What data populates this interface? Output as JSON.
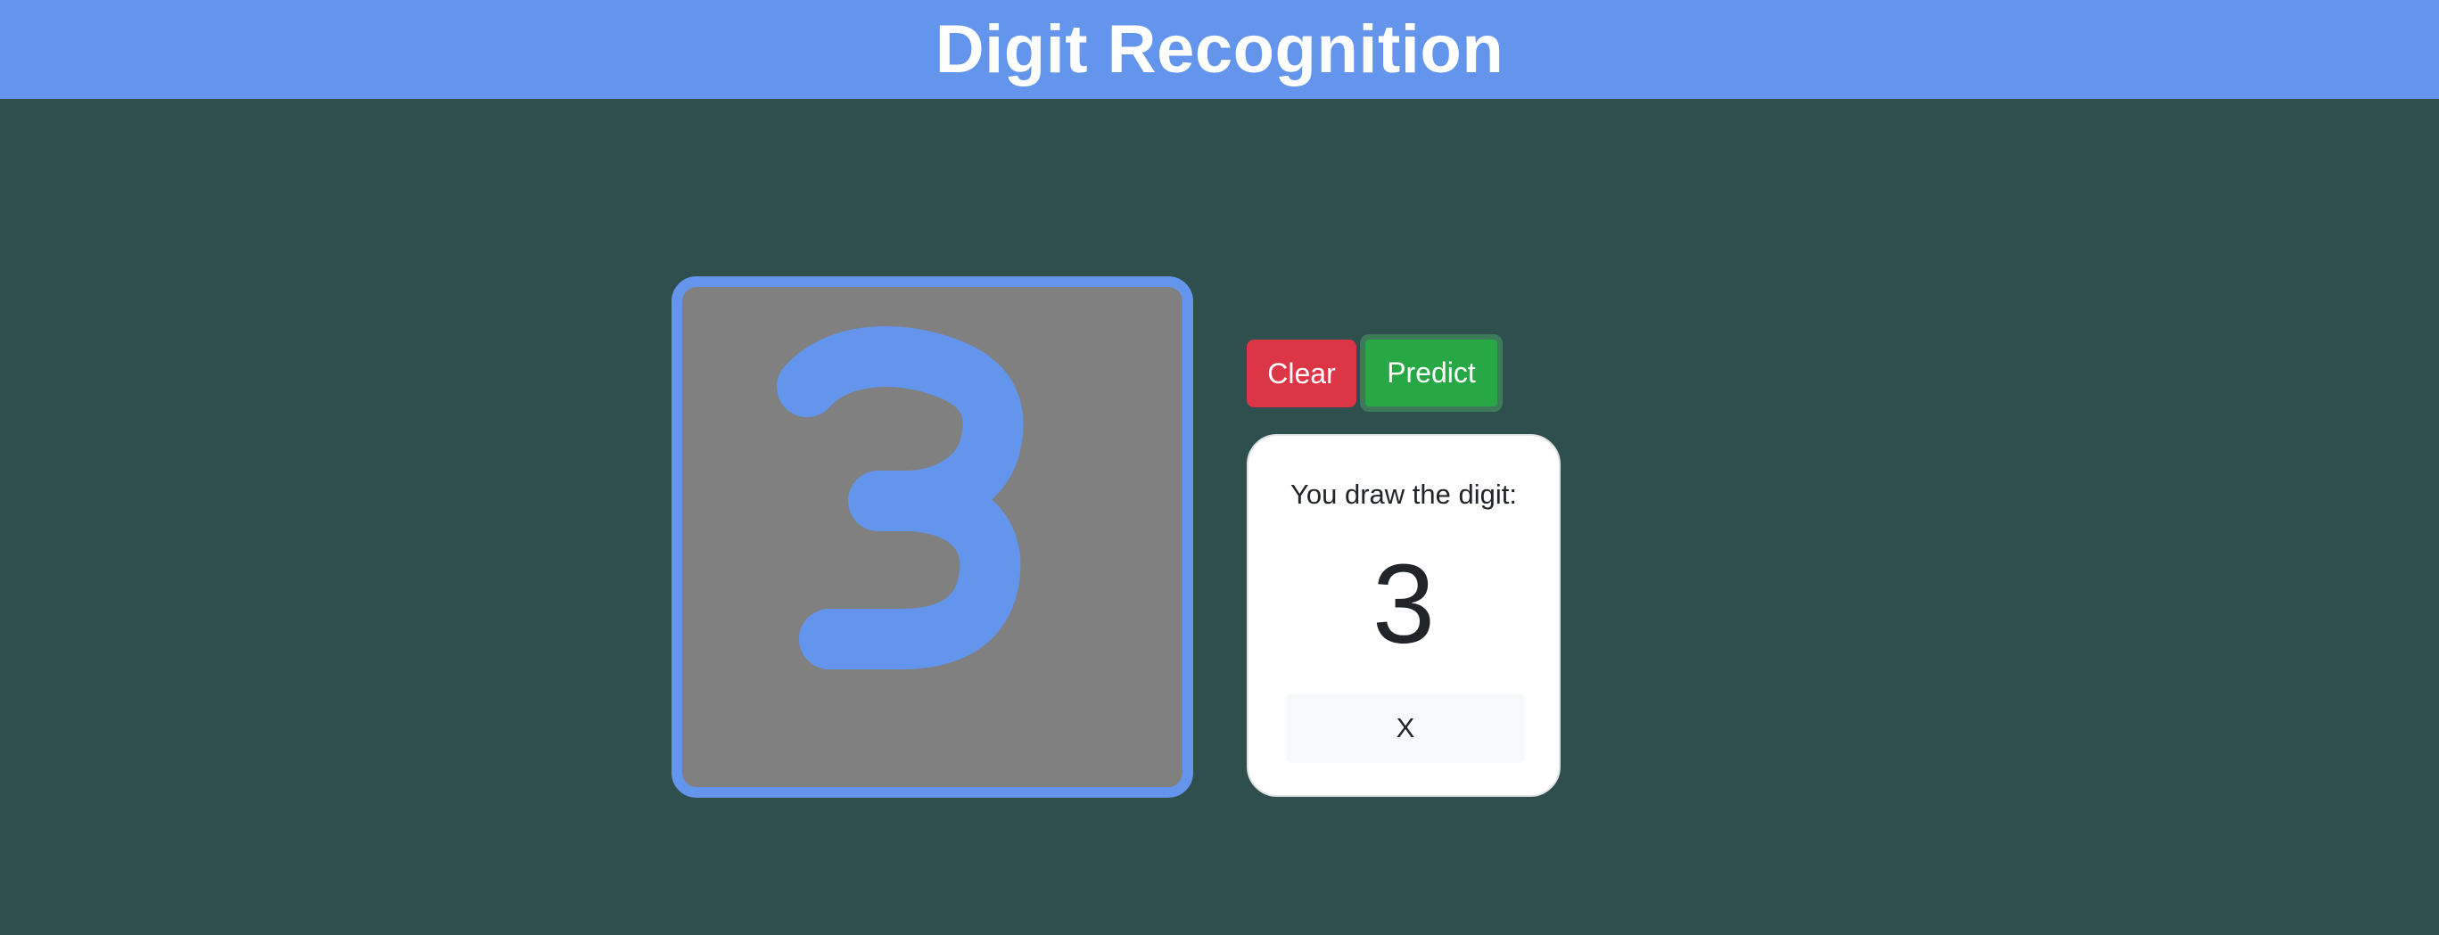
{
  "header": {
    "title": "Digit Recognition"
  },
  "canvas": {
    "stroke_color": "#6495ed",
    "background_color": "#808080"
  },
  "controls": {
    "clear_label": "Clear",
    "predict_label": "Predict"
  },
  "result": {
    "label": "You draw the digit:",
    "digit": "3",
    "close_label": "X"
  },
  "colors": {
    "page_background": "#2f4f4f",
    "header_background": "#6495ed",
    "clear_button": "#dc3545",
    "predict_button": "#28a745"
  }
}
